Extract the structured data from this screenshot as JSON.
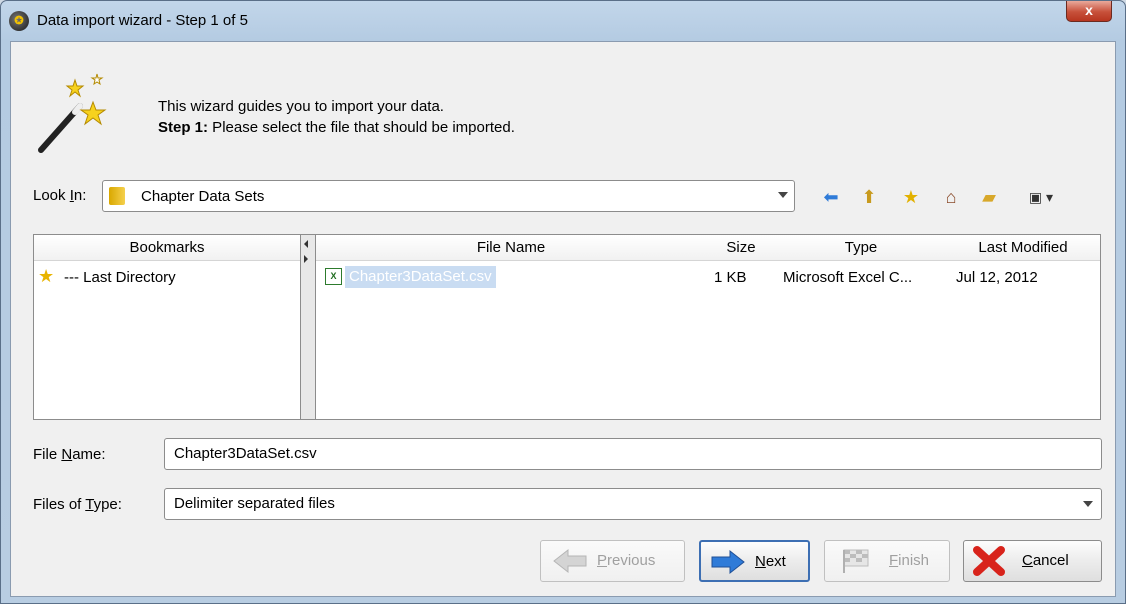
{
  "window": {
    "title": "Data import wizard - Step 1 of 5",
    "close_glyph": "x",
    "app_icon": "rapidminer-icon"
  },
  "intro": {
    "line1": "This wizard guides you to import your data.",
    "line2_bold": "Step 1:",
    "line2_rest": " Please select the file that should be imported."
  },
  "look_in": {
    "label_pre": "Look ",
    "label_u": "I",
    "label_post": "n:",
    "value": "Chapter Data Sets"
  },
  "toolbar": {
    "icons": [
      "back-arrow-icon",
      "up-folder-icon",
      "add-bookmark-icon",
      "home-icon",
      "new-folder-icon",
      "view-menu-icon"
    ]
  },
  "bookmarks": {
    "header": "Bookmarks",
    "items": [
      {
        "label": "--- Last Directory"
      }
    ]
  },
  "files": {
    "columns": [
      "File Name",
      "Size",
      "Type",
      "Last Modified"
    ],
    "rows": [
      {
        "name": "Chapter3DataSet.csv",
        "size": "1 KB",
        "type": "Microsoft Excel C...",
        "modified": "Jul 12, 2012",
        "selected": true
      }
    ]
  },
  "file_name": {
    "label_pre": "File ",
    "label_u": "N",
    "label_post": "ame:",
    "value": "Chapter3DataSet.csv"
  },
  "file_type": {
    "label_pre": "Files of ",
    "label_u": "T",
    "label_post": "ype:",
    "value": "Delimiter separated files"
  },
  "buttons": {
    "previous": {
      "u": "P",
      "rest": "revious",
      "enabled": false
    },
    "next": {
      "u": "N",
      "rest": "ext",
      "enabled": true
    },
    "finish": {
      "u": "F",
      "rest": "inish",
      "enabled": false
    },
    "cancel": {
      "u": "C",
      "rest": "ancel",
      "enabled": true
    }
  },
  "colors": {
    "selection": "#c9dcf2",
    "accent_blue": "#2f7bd8",
    "cancel_red": "#d8231b"
  }
}
